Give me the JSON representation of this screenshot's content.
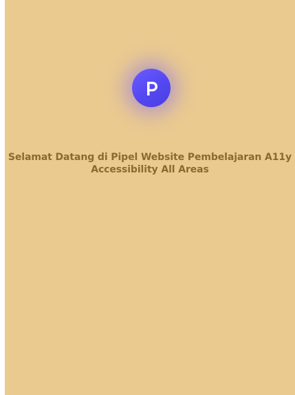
{
  "logo": {
    "icon": "pipel-logo-icon",
    "color": "#5a4df5"
  },
  "welcome": {
    "line1": "Selamat Datang di Pipel Website Pembelajaran A11y",
    "line2": "Accessibility All Areas"
  },
  "colors": {
    "background": "#ebca90",
    "text": "#8b6a2e"
  }
}
